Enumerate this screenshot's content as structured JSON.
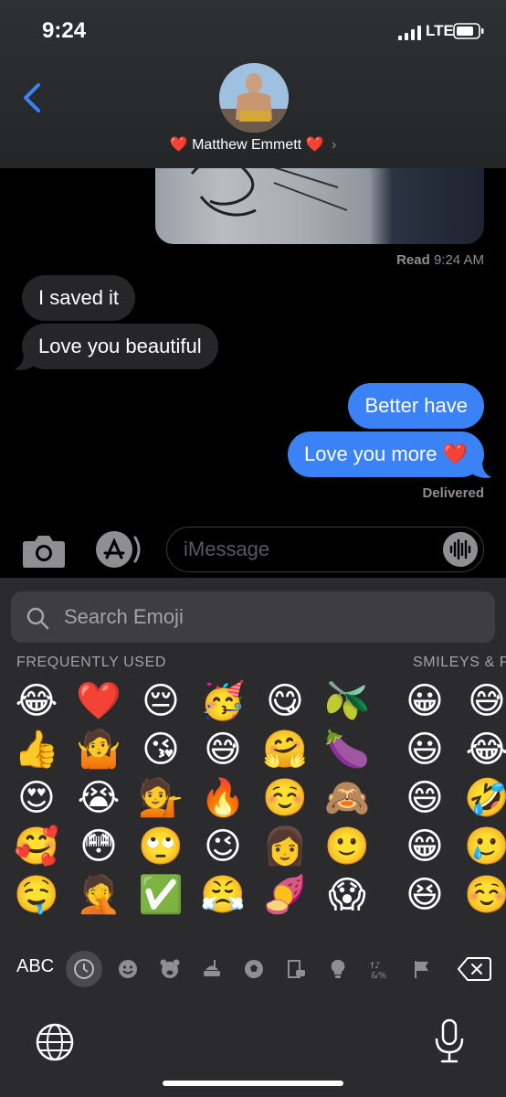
{
  "status_bar": {
    "time": "9:24",
    "network": "LTE"
  },
  "header": {
    "contact_name": "Matthew Emmett",
    "heart": "❤️",
    "chevron": "›"
  },
  "conversation": {
    "read_receipt": {
      "label": "Read",
      "time": "9:24 AM"
    },
    "messages": [
      {
        "direction": "incoming",
        "text": "I saved it"
      },
      {
        "direction": "incoming",
        "text": "Love you beautiful"
      },
      {
        "direction": "outgoing",
        "text": "Better have"
      },
      {
        "direction": "outgoing",
        "text": "Love you more ❤️"
      }
    ],
    "delivered": "Delivered"
  },
  "composer": {
    "placeholder": "iMessage"
  },
  "keyboard": {
    "search_placeholder": "Search Emoji",
    "sections": {
      "frequently_used": "FREQUENTLY USED",
      "smileys": "SMILEYS & P"
    },
    "frequently_used": [
      [
        "😂",
        "❤️",
        "😔",
        "🥳",
        "😋",
        "🫒"
      ],
      [
        "👍",
        "🤷",
        "😘",
        "😅",
        "🤗",
        "🍆"
      ],
      [
        "😍",
        "😭",
        "💁",
        "🔥",
        "☺️",
        "🙈"
      ],
      [
        "🥰",
        "😳",
        "🙄",
        "😉",
        "👩",
        "🙂"
      ],
      [
        "🤤",
        "🤦",
        "✅",
        "😤",
        "🍠",
        "😱"
      ]
    ],
    "smileys_preview": [
      [
        "😀",
        "😅"
      ],
      [
        "😃",
        "😂"
      ],
      [
        "😄",
        "🤣"
      ],
      [
        "😁",
        "🥲"
      ],
      [
        "😆",
        "☺️"
      ]
    ],
    "abc_label": "ABC",
    "categories": [
      "recents",
      "smileys",
      "animals",
      "food",
      "activity",
      "travel",
      "objects",
      "symbols",
      "flags"
    ],
    "active_category": "recents"
  },
  "colors": {
    "outgoing_bubble": "#3b82f6",
    "incoming_bubble": "#262628",
    "keyboard_bg": "#2b2b2d"
  }
}
